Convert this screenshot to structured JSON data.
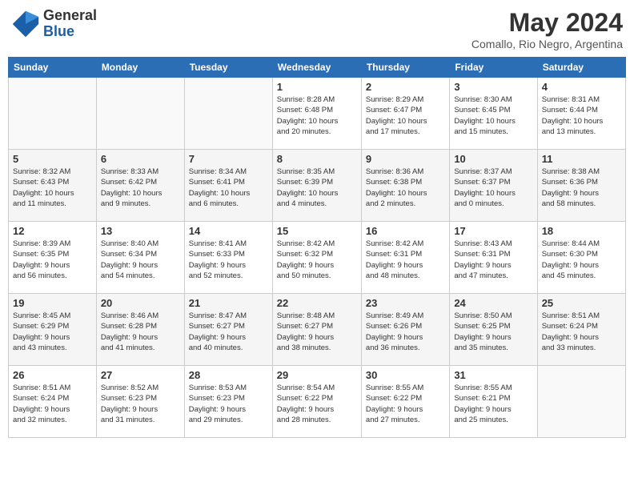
{
  "header": {
    "logo_general": "General",
    "logo_blue": "Blue",
    "month": "May 2024",
    "location": "Comallo, Rio Negro, Argentina"
  },
  "weekdays": [
    "Sunday",
    "Monday",
    "Tuesday",
    "Wednesday",
    "Thursday",
    "Friday",
    "Saturday"
  ],
  "weeks": [
    [
      {
        "day": "",
        "info": ""
      },
      {
        "day": "",
        "info": ""
      },
      {
        "day": "",
        "info": ""
      },
      {
        "day": "1",
        "info": "Sunrise: 8:28 AM\nSunset: 6:48 PM\nDaylight: 10 hours\nand 20 minutes."
      },
      {
        "day": "2",
        "info": "Sunrise: 8:29 AM\nSunset: 6:47 PM\nDaylight: 10 hours\nand 17 minutes."
      },
      {
        "day": "3",
        "info": "Sunrise: 8:30 AM\nSunset: 6:45 PM\nDaylight: 10 hours\nand 15 minutes."
      },
      {
        "day": "4",
        "info": "Sunrise: 8:31 AM\nSunset: 6:44 PM\nDaylight: 10 hours\nand 13 minutes."
      }
    ],
    [
      {
        "day": "5",
        "info": "Sunrise: 8:32 AM\nSunset: 6:43 PM\nDaylight: 10 hours\nand 11 minutes."
      },
      {
        "day": "6",
        "info": "Sunrise: 8:33 AM\nSunset: 6:42 PM\nDaylight: 10 hours\nand 9 minutes."
      },
      {
        "day": "7",
        "info": "Sunrise: 8:34 AM\nSunset: 6:41 PM\nDaylight: 10 hours\nand 6 minutes."
      },
      {
        "day": "8",
        "info": "Sunrise: 8:35 AM\nSunset: 6:39 PM\nDaylight: 10 hours\nand 4 minutes."
      },
      {
        "day": "9",
        "info": "Sunrise: 8:36 AM\nSunset: 6:38 PM\nDaylight: 10 hours\nand 2 minutes."
      },
      {
        "day": "10",
        "info": "Sunrise: 8:37 AM\nSunset: 6:37 PM\nDaylight: 10 hours\nand 0 minutes."
      },
      {
        "day": "11",
        "info": "Sunrise: 8:38 AM\nSunset: 6:36 PM\nDaylight: 9 hours\nand 58 minutes."
      }
    ],
    [
      {
        "day": "12",
        "info": "Sunrise: 8:39 AM\nSunset: 6:35 PM\nDaylight: 9 hours\nand 56 minutes."
      },
      {
        "day": "13",
        "info": "Sunrise: 8:40 AM\nSunset: 6:34 PM\nDaylight: 9 hours\nand 54 minutes."
      },
      {
        "day": "14",
        "info": "Sunrise: 8:41 AM\nSunset: 6:33 PM\nDaylight: 9 hours\nand 52 minutes."
      },
      {
        "day": "15",
        "info": "Sunrise: 8:42 AM\nSunset: 6:32 PM\nDaylight: 9 hours\nand 50 minutes."
      },
      {
        "day": "16",
        "info": "Sunrise: 8:42 AM\nSunset: 6:31 PM\nDaylight: 9 hours\nand 48 minutes."
      },
      {
        "day": "17",
        "info": "Sunrise: 8:43 AM\nSunset: 6:31 PM\nDaylight: 9 hours\nand 47 minutes."
      },
      {
        "day": "18",
        "info": "Sunrise: 8:44 AM\nSunset: 6:30 PM\nDaylight: 9 hours\nand 45 minutes."
      }
    ],
    [
      {
        "day": "19",
        "info": "Sunrise: 8:45 AM\nSunset: 6:29 PM\nDaylight: 9 hours\nand 43 minutes."
      },
      {
        "day": "20",
        "info": "Sunrise: 8:46 AM\nSunset: 6:28 PM\nDaylight: 9 hours\nand 41 minutes."
      },
      {
        "day": "21",
        "info": "Sunrise: 8:47 AM\nSunset: 6:27 PM\nDaylight: 9 hours\nand 40 minutes."
      },
      {
        "day": "22",
        "info": "Sunrise: 8:48 AM\nSunset: 6:27 PM\nDaylight: 9 hours\nand 38 minutes."
      },
      {
        "day": "23",
        "info": "Sunrise: 8:49 AM\nSunset: 6:26 PM\nDaylight: 9 hours\nand 36 minutes."
      },
      {
        "day": "24",
        "info": "Sunrise: 8:50 AM\nSunset: 6:25 PM\nDaylight: 9 hours\nand 35 minutes."
      },
      {
        "day": "25",
        "info": "Sunrise: 8:51 AM\nSunset: 6:24 PM\nDaylight: 9 hours\nand 33 minutes."
      }
    ],
    [
      {
        "day": "26",
        "info": "Sunrise: 8:51 AM\nSunset: 6:24 PM\nDaylight: 9 hours\nand 32 minutes."
      },
      {
        "day": "27",
        "info": "Sunrise: 8:52 AM\nSunset: 6:23 PM\nDaylight: 9 hours\nand 31 minutes."
      },
      {
        "day": "28",
        "info": "Sunrise: 8:53 AM\nSunset: 6:23 PM\nDaylight: 9 hours\nand 29 minutes."
      },
      {
        "day": "29",
        "info": "Sunrise: 8:54 AM\nSunset: 6:22 PM\nDaylight: 9 hours\nand 28 minutes."
      },
      {
        "day": "30",
        "info": "Sunrise: 8:55 AM\nSunset: 6:22 PM\nDaylight: 9 hours\nand 27 minutes."
      },
      {
        "day": "31",
        "info": "Sunrise: 8:55 AM\nSunset: 6:21 PM\nDaylight: 9 hours\nand 25 minutes."
      },
      {
        "day": "",
        "info": ""
      }
    ]
  ]
}
